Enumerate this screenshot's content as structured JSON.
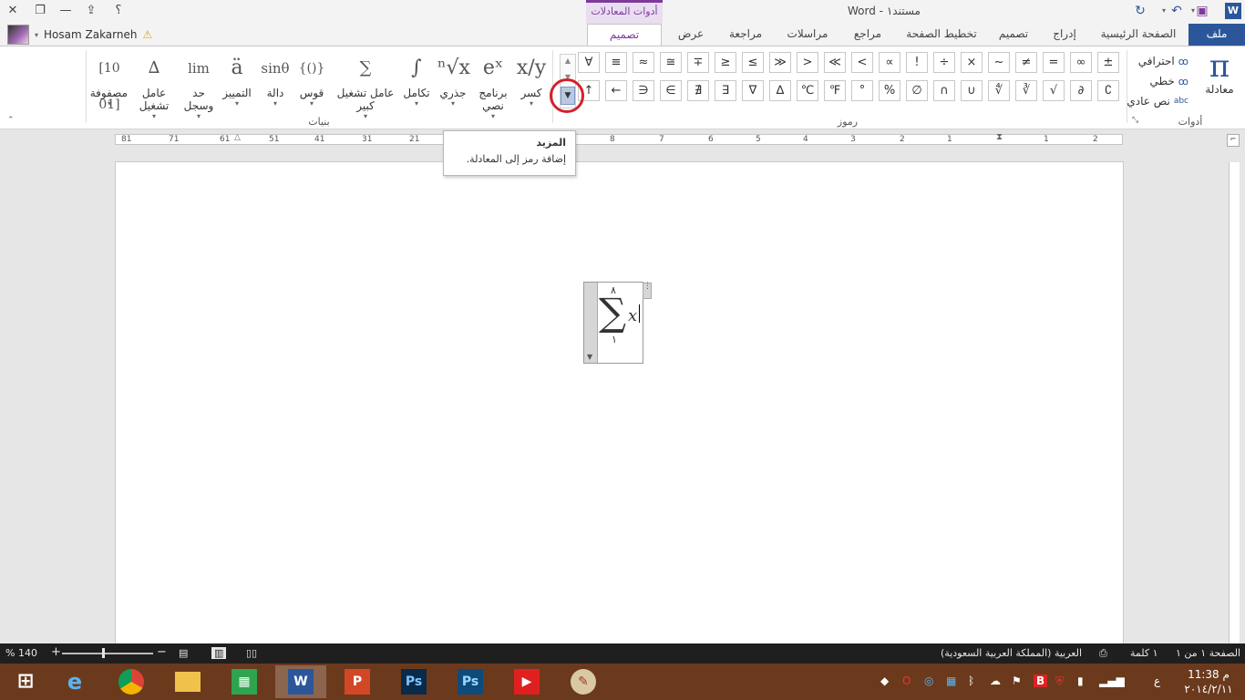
{
  "titlebar": {
    "app_title": "مستند١ - Word",
    "context_tab": "أدوات المعادلات",
    "help": "؟",
    "word_logo": "W"
  },
  "tabs": {
    "file": "ملف",
    "home": "الصفحة الرئيسية",
    "insert": "إدراج",
    "design": "تصميم",
    "layout": "تخطيط الصفحة",
    "references": "مراجع",
    "mailings": "مراسلات",
    "review": "مراجعة",
    "view": "عرض",
    "eq_design": "تصميم"
  },
  "user": {
    "name": "Hosam Zakarneh"
  },
  "tools_group": {
    "equation_label": "معادلة",
    "professional": "احترافي",
    "linear": "خطي",
    "normal_text": "نص عادي",
    "group_label": "أدوات"
  },
  "symbols_group": {
    "row1": [
      "±",
      "∞",
      "=",
      "≠",
      "~",
      "×",
      "÷",
      "!",
      "∝",
      "<",
      "≪",
      ">",
      "≫",
      "≤",
      "≥",
      "∓",
      "≅",
      "≈",
      "≡",
      "∀"
    ],
    "row2": [
      "∁",
      "∂",
      "√",
      "∛",
      "∜",
      "∪",
      "∩",
      "∅",
      "%",
      "°",
      "℉",
      "℃",
      "∆",
      "∇",
      "∃",
      "∄",
      "∈",
      "∋",
      "←",
      "↑"
    ],
    "group_label": "رموز"
  },
  "structures_group": {
    "items": [
      {
        "label": "كسر",
        "icon": "x/y"
      },
      {
        "label": "برنامج نصي",
        "icon": "eˣ"
      },
      {
        "label": "جذري",
        "icon": "ⁿ√x"
      },
      {
        "label": "تكامل",
        "icon": "∫"
      },
      {
        "label": "عامل تشغيل كبير",
        "icon": "∑"
      },
      {
        "label": "قوس",
        "icon": "{()}"
      },
      {
        "label": "دالة",
        "icon": "sinθ"
      },
      {
        "label": "التمييز",
        "icon": "ä"
      },
      {
        "label": "حد وسجل",
        "icon": "lim"
      },
      {
        "label": "عامل تشغيل",
        "icon": "∆"
      },
      {
        "label": "مصفوفة",
        "icon": "[10 01]"
      }
    ],
    "group_label": "بنيات"
  },
  "tooltip": {
    "title": "المزيد",
    "description": "إضافة رمز إلى المعادلة."
  },
  "ruler": {
    "left_numbers": [
      "81",
      "71",
      "61",
      "51",
      "41",
      "31",
      "21"
    ],
    "right_numbers": [
      "8",
      "7",
      "6",
      "5",
      "4",
      "3",
      "2",
      "1",
      "1",
      "2"
    ]
  },
  "equation": {
    "upper": "٨",
    "operator": "∑",
    "variable": "x",
    "lower": "١"
  },
  "statusbar": {
    "page": "الصفحة ١ من ١",
    "words": "١ كلمة",
    "language": "العربية (المملكة العربية السعودية)",
    "zoom": "140 %"
  },
  "taskbar": {
    "clock_time": "11:38 م",
    "clock_date": "٢٠١٤/٢/١١",
    "lang_indicator": "ع"
  },
  "colors": {
    "word_blue": "#2b579a",
    "eq_tools_purple": "#7e3a9b",
    "highlight_red": "#d3202a"
  }
}
